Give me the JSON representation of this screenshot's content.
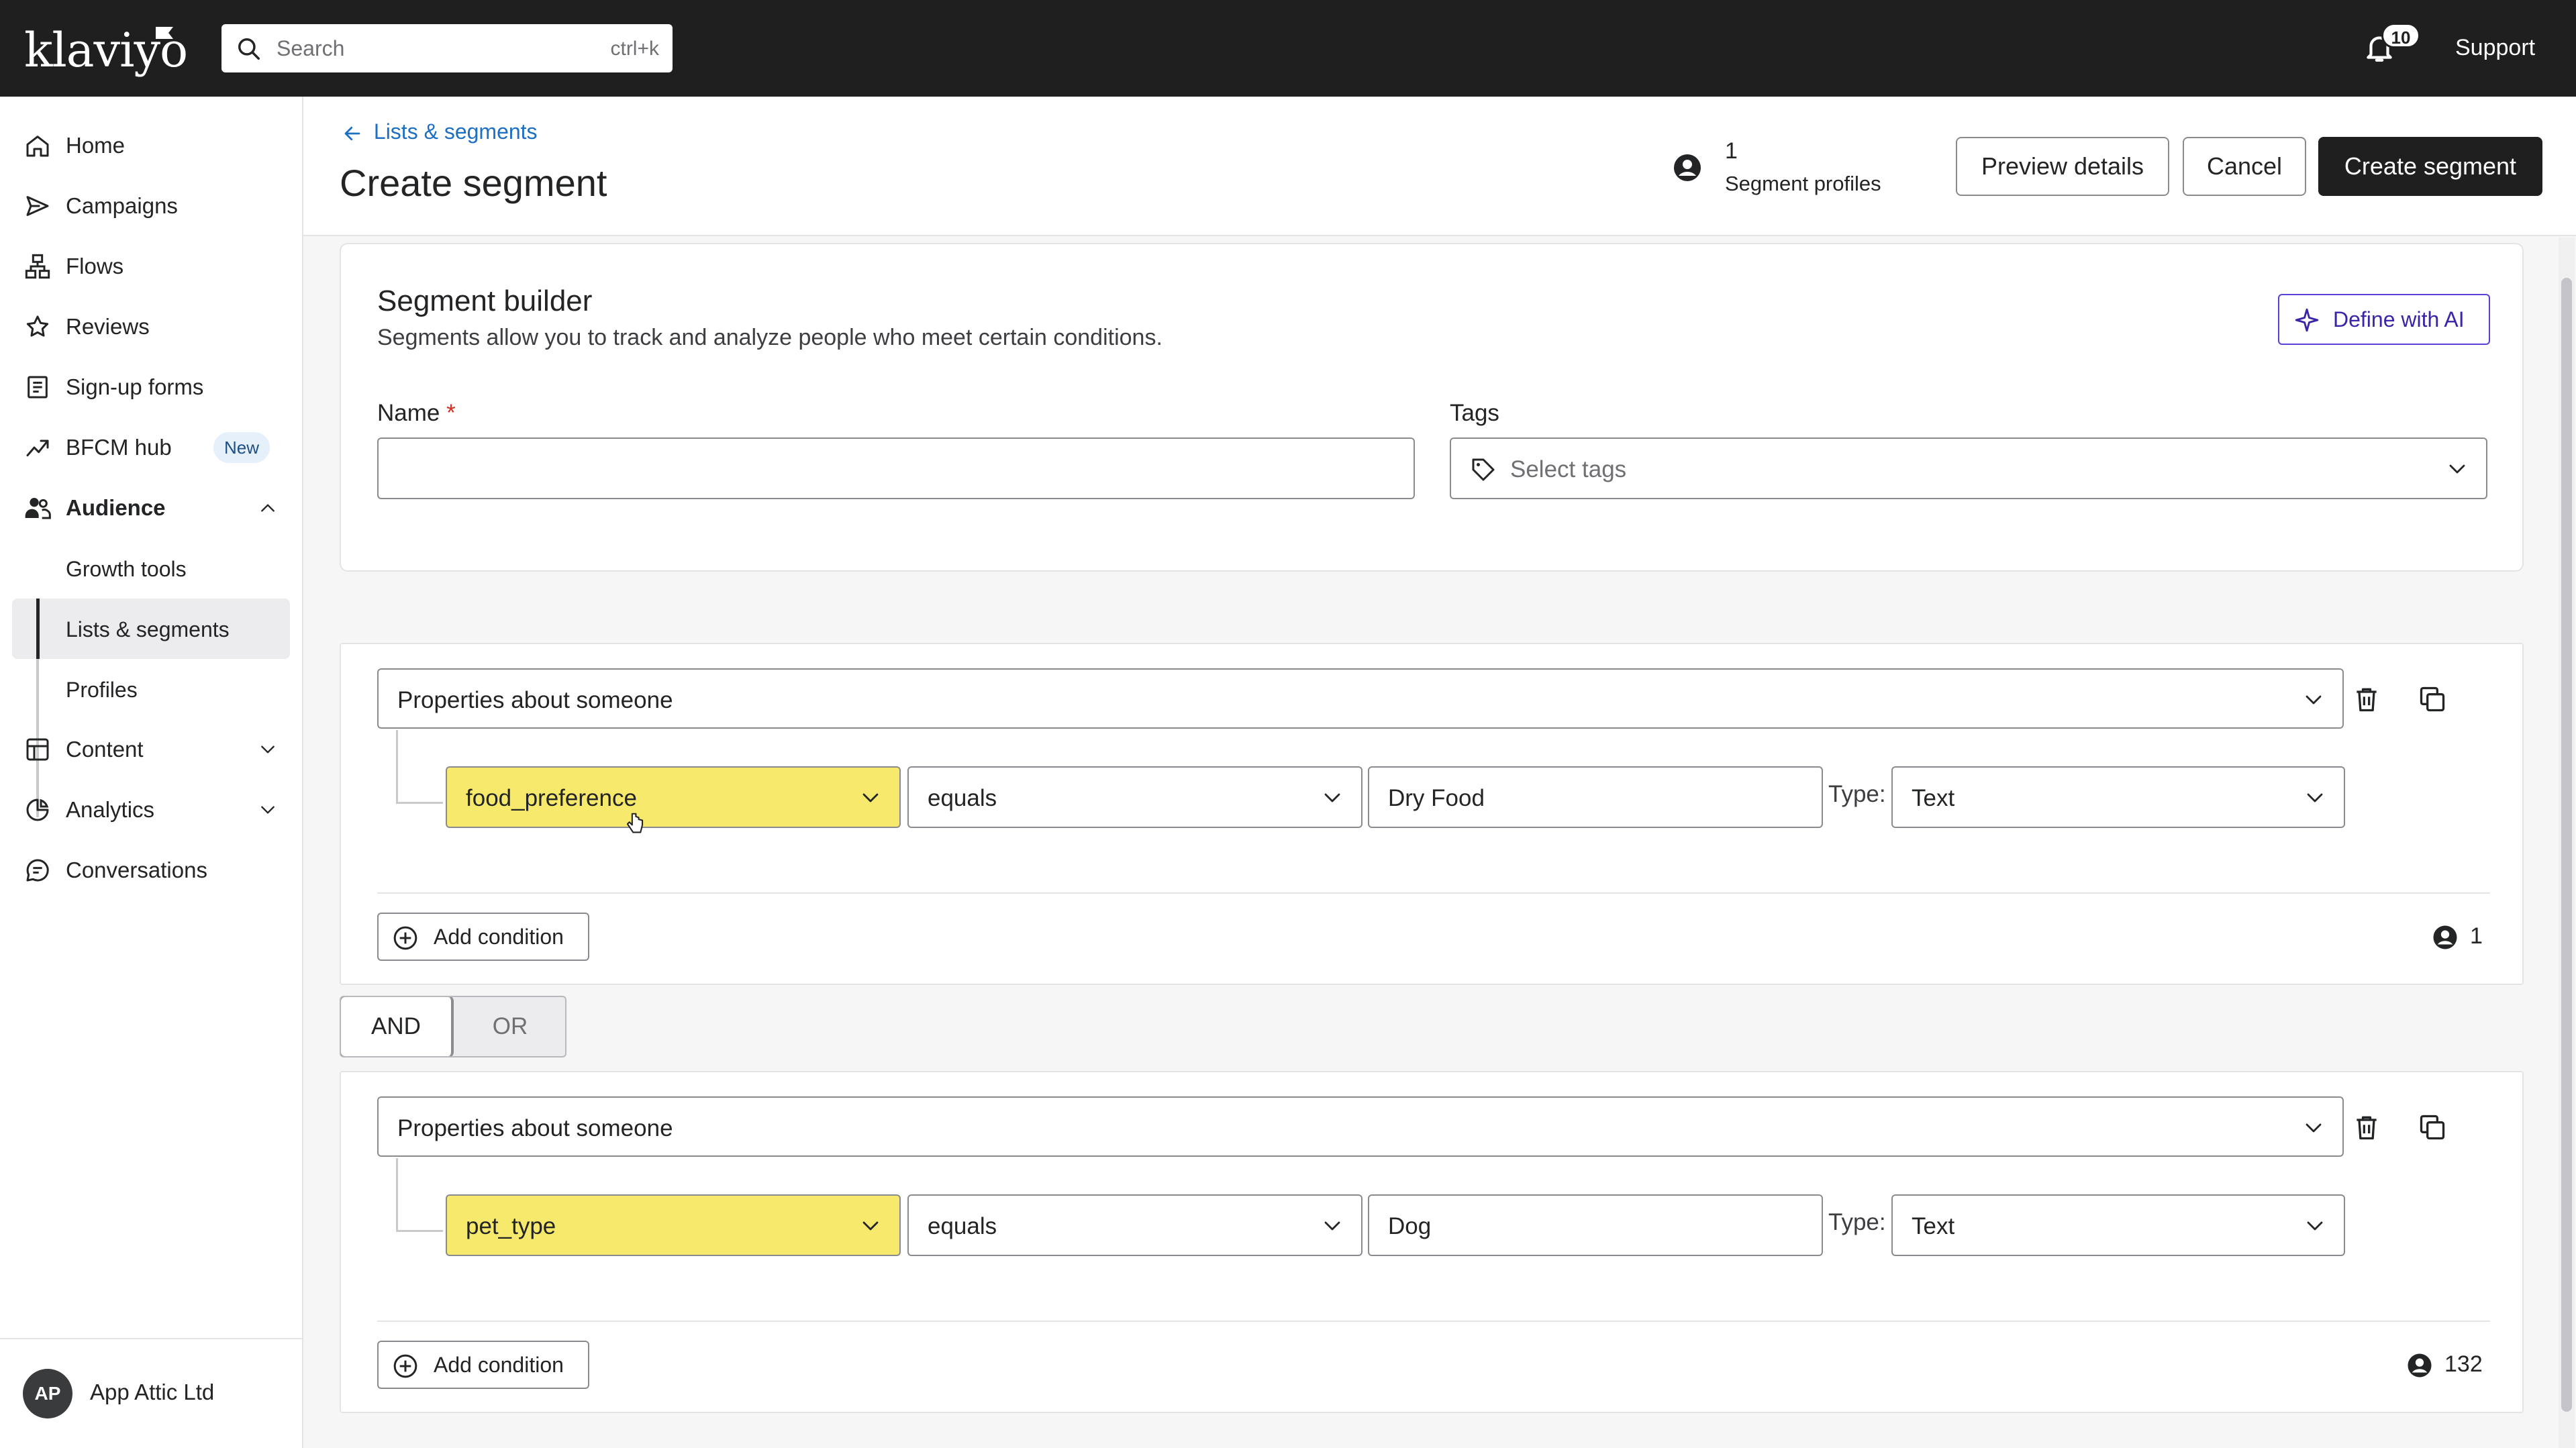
{
  "app": {
    "logo_text": "klaviyo"
  },
  "topbar": {
    "search_placeholder": "Search",
    "search_shortcut": "ctrl+k",
    "notification_count": "10",
    "support_label": "Support"
  },
  "sidebar": {
    "items": [
      {
        "label": "Home",
        "icon": "home-icon"
      },
      {
        "label": "Campaigns",
        "icon": "send-icon"
      },
      {
        "label": "Flows",
        "icon": "flows-icon"
      },
      {
        "label": "Reviews",
        "icon": "star-icon"
      },
      {
        "label": "Sign-up forms",
        "icon": "form-icon"
      },
      {
        "label": "BFCM hub",
        "icon": "trend-icon",
        "badge": "New"
      },
      {
        "label": "Audience",
        "icon": "people-icon"
      },
      {
        "label": "Content",
        "icon": "content-icon"
      },
      {
        "label": "Analytics",
        "icon": "analytics-icon"
      },
      {
        "label": "Conversations",
        "icon": "chat-icon"
      }
    ],
    "audience_sub": [
      "Growth tools",
      "Lists & segments",
      "Profiles"
    ],
    "footer": {
      "initials": "AP",
      "company": "App Attic Ltd"
    }
  },
  "header": {
    "back_label": "Lists & segments",
    "title": "Create segment",
    "segment_count": "1",
    "segment_count_label": "Segment profiles",
    "preview_label": "Preview details",
    "cancel_label": "Cancel",
    "create_label": "Create segment"
  },
  "builder": {
    "title": "Segment builder",
    "subtitle": "Segments allow you to track and analyze people who meet certain conditions.",
    "ai_label": "Define with AI",
    "name_label": "Name",
    "name_required": "*",
    "name_value": "",
    "tags_label": "Tags",
    "tags_placeholder": "Select tags"
  },
  "groups": [
    {
      "definition": "Properties about someone",
      "property": "food_preference",
      "operator": "equals",
      "value": "Dry Food",
      "type_label": "Type:",
      "type": "Text",
      "add_label": "Add condition",
      "count": "1"
    },
    {
      "definition": "Properties about someone",
      "property": "pet_type",
      "operator": "equals",
      "value": "Dog",
      "type_label": "Type:",
      "type": "Text",
      "add_label": "Add condition",
      "count": "132"
    }
  ],
  "logic": {
    "and_label": "AND",
    "or_label": "OR",
    "selected": "AND"
  }
}
